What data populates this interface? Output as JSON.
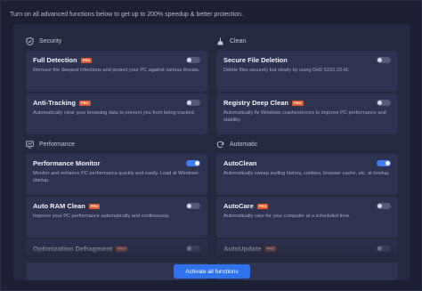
{
  "banner": "Turn on all advanced functions below to get up to 200% speedup & better protection.",
  "sections": {
    "security": {
      "title": "Security",
      "icon": "shield-icon"
    },
    "clean": {
      "title": "Clean",
      "icon": "broom-icon"
    },
    "performance": {
      "title": "Performance",
      "icon": "monitor-icon"
    },
    "automatic": {
      "title": "Automatic",
      "icon": "refresh-icon"
    }
  },
  "badge": "PRO",
  "features": {
    "full_detection": {
      "name": "Full Detection",
      "desc": "Remove the deepest infections and protect your PC against various threats.",
      "on": false
    },
    "anti_tracking": {
      "name": "Anti-Tracking",
      "desc": "Automatically clear your browsing data to prevent you from being tracked.",
      "on": false
    },
    "secure_file_deletion": {
      "name": "Secure File Deletion",
      "desc": "Delete files securely but slowly by using DoD 5220.22-M.",
      "on": false
    },
    "registry_deep_clean": {
      "name": "Registry Deep Clean",
      "desc": "Automatically fix Windows crashes/errors to improve PC performance and stability.",
      "on": false
    },
    "performance_monitor": {
      "name": "Performance Monitor",
      "desc": "Monitor and enhance PC performance quickly and easily. Load at Windows startup.",
      "on": true
    },
    "auto_ram_clean": {
      "name": "Auto RAM Clean",
      "desc": "Improve your PC performance automatically and continuously.",
      "on": false
    },
    "optimization_defragment": {
      "name": "Optimization Defragment",
      "desc": "",
      "on": false
    },
    "autoclean": {
      "name": "AutoClean",
      "desc": "Automatically sweep surfing history, cookies, browser cache, etc. at bootup.",
      "on": true
    },
    "autocare": {
      "name": "AutoCare",
      "desc": "Automatically care for your computer at a scheduled time.",
      "on": false
    },
    "autoupdate": {
      "name": "AutoUpdate",
      "desc": "",
      "on": false
    }
  },
  "action_button": "Activate all functions"
}
